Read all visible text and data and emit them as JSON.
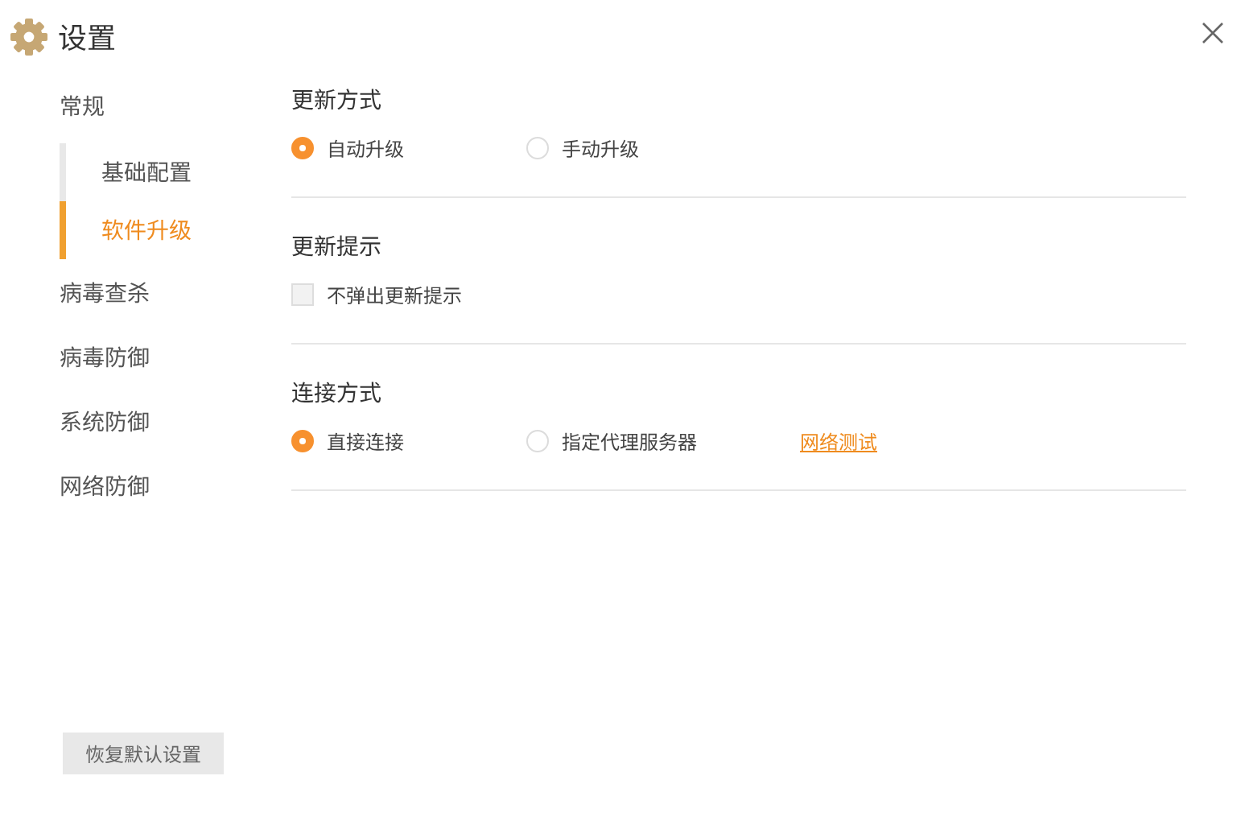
{
  "window": {
    "title": "设置"
  },
  "sidebar": {
    "items": [
      {
        "label": "常规",
        "selected": false,
        "children": [
          {
            "label": "基础配置",
            "selected": false
          },
          {
            "label": "软件升级",
            "selected": true
          }
        ]
      },
      {
        "label": "病毒查杀",
        "selected": false
      },
      {
        "label": "病毒防御",
        "selected": false
      },
      {
        "label": "系统防御",
        "selected": false
      },
      {
        "label": "网络防御",
        "selected": false
      }
    ]
  },
  "sections": [
    {
      "title": "更新方式",
      "options": [
        {
          "kind": "radio",
          "label": "自动升级",
          "selected": true
        },
        {
          "kind": "radio",
          "label": "手动升级",
          "selected": false
        }
      ]
    },
    {
      "title": "更新提示",
      "options": [
        {
          "kind": "checkbox",
          "label": "不弹出更新提示",
          "checked": false
        }
      ]
    },
    {
      "title": "连接方式",
      "options": [
        {
          "kind": "radio",
          "label": "直接连接",
          "selected": true
        },
        {
          "kind": "radio",
          "label": "指定代理服务器",
          "selected": false
        },
        {
          "kind": "link",
          "label": "网络测试"
        }
      ]
    }
  ],
  "restore_button": "恢复默认设置"
}
